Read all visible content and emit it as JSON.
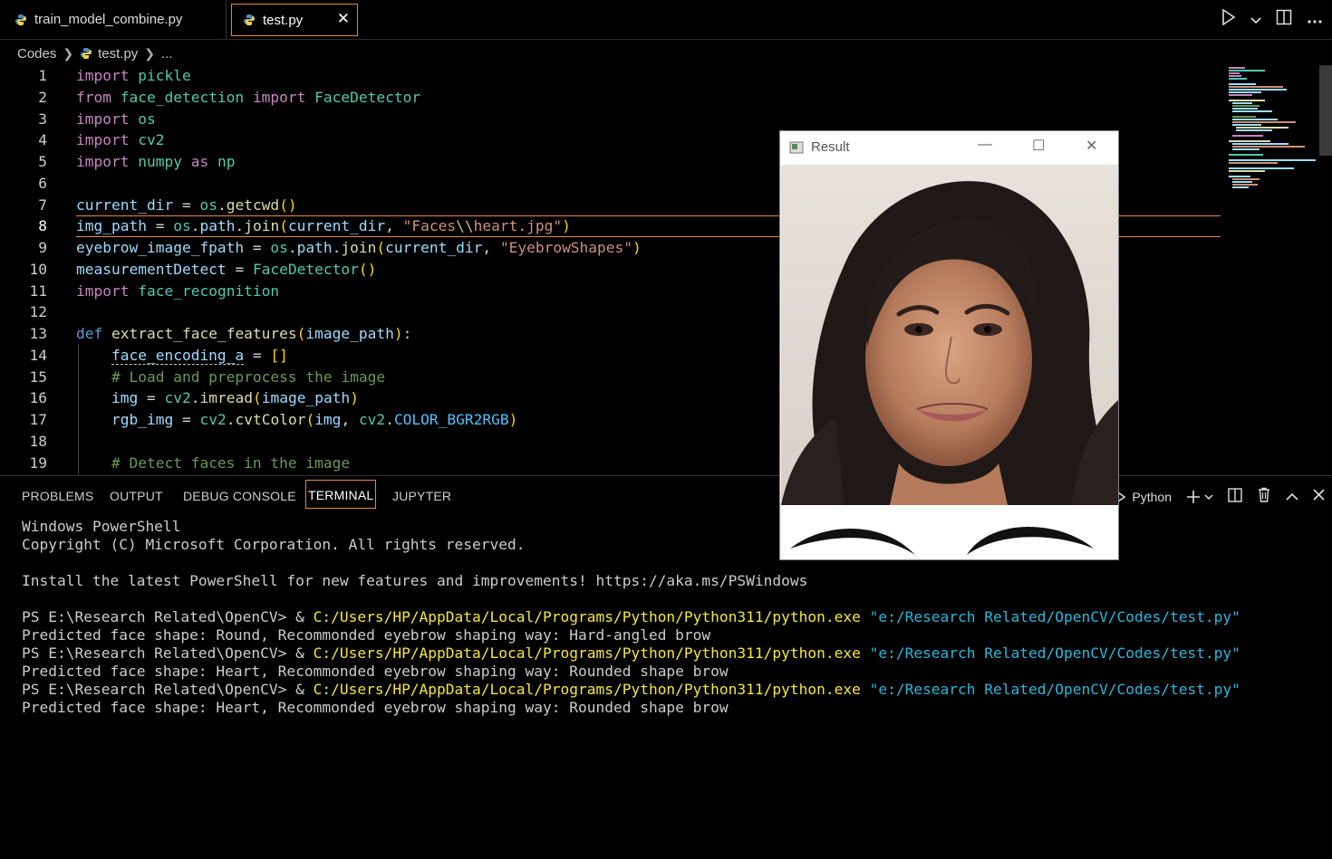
{
  "tabs": [
    {
      "label": "train_model_combine.py",
      "icon": "python-icon",
      "active": false
    },
    {
      "label": "test.py",
      "icon": "python-icon",
      "active": true,
      "close": "✕"
    }
  ],
  "breadcrumb": {
    "folder": "Codes",
    "file": "test.py",
    "more": "..."
  },
  "line_numbers": [
    "1",
    "2",
    "3",
    "4",
    "5",
    "6",
    "7",
    "8",
    "9",
    "10",
    "11",
    "12",
    "13",
    "14",
    "15",
    "16",
    "17",
    "18",
    "19"
  ],
  "current_line": 8,
  "panel": {
    "tabs": [
      "PROBLEMS",
      "OUTPUT",
      "DEBUG CONSOLE",
      "TERMINAL",
      "JUPYTER"
    ],
    "active_tab": "TERMINAL",
    "shell_label": "Python"
  },
  "terminal": {
    "header1": "Windows PowerShell",
    "header2": "Copyright (C) Microsoft Corporation. All rights reserved.",
    "header3": "Install the latest PowerShell for new features and improvements! https://aka.ms/PSWindows",
    "runs": [
      {
        "prompt": "PS E:\\Research Related\\OpenCV> & ",
        "exe": "C:/Users/HP/AppData/Local/Programs/Python/Python311/python.exe",
        "arg": " \"e:/Research Related/OpenCV/Codes/test.py\"",
        "output": "Predicted face shape: Round, Recommonded eyebrow shaping way: Hard-angled brow"
      },
      {
        "prompt": "PS E:\\Research Related\\OpenCV> & ",
        "exe": "C:/Users/HP/AppData/Local/Programs/Python/Python311/python.exe",
        "arg": " \"e:/Research Related/OpenCV/Codes/test.py\"",
        "output": "Predicted face shape: Heart, Recommonded eyebrow shaping way: Rounded shape brow"
      },
      {
        "prompt": "PS E:\\Research Related\\OpenCV> & ",
        "exe": "C:/Users/HP/AppData/Local/Programs/Python/Python311/python.exe",
        "arg": " \"e:/Research Related/OpenCV/Codes/test.py\"",
        "output": "Predicted face shape: Heart, Recommonded eyebrow shaping way: Rounded shape brow"
      }
    ]
  },
  "result_window": {
    "title": "Result",
    "minimize": "—",
    "maximize": "☐",
    "close": "✕"
  },
  "colors": {
    "accent": "#e28a3c",
    "keyword": "#c586c0",
    "string": "#ce9178",
    "variable": "#9cdcfe",
    "function": "#dcdcaa",
    "comment": "#6a9955",
    "terminal_exe": "#f5e73a",
    "terminal_arg": "#29b8db"
  }
}
